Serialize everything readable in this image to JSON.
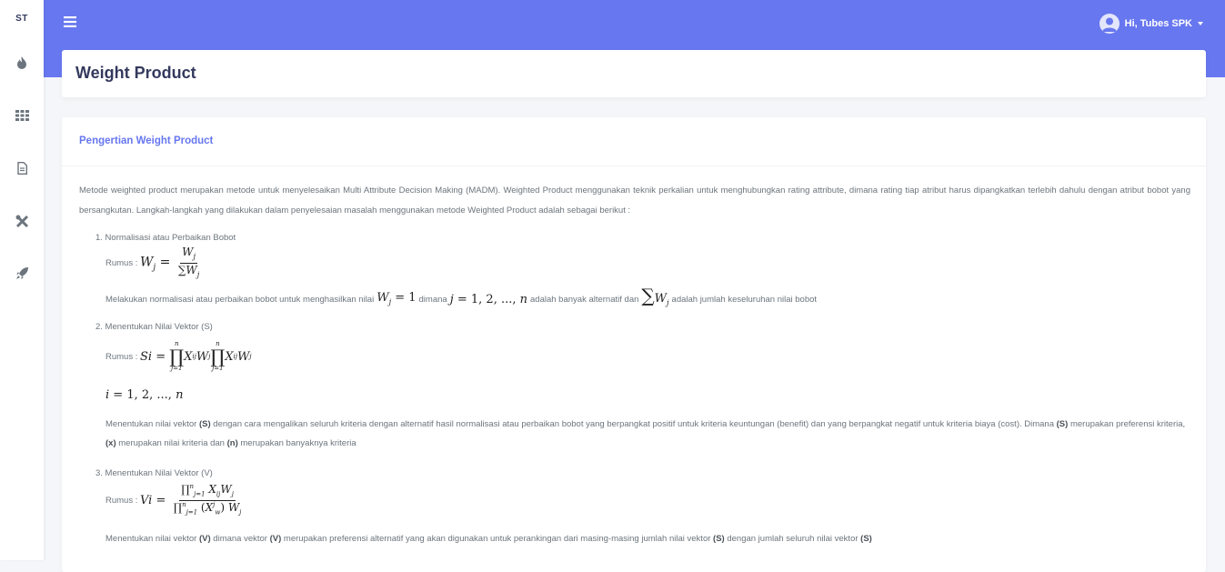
{
  "sidebar": {
    "brand": "ST",
    "icons": [
      "fire-icon",
      "grid-icon",
      "file-icon",
      "tools-icon",
      "rocket-icon"
    ]
  },
  "navbar": {
    "user_greeting": "Hi, Tubes SPK",
    "accent_color": "#6777ef"
  },
  "page": {
    "title": "Weight Product"
  },
  "card": {
    "title": "Pengertian Weight Product",
    "intro": "Metode weighted product merupakan metode untuk menyelesaikan Multi Attribute Decision Making (MADM). Weighted Product menggunakan teknik perkalian untuk menghubungkan rating attribute, dimana rating tiap atribut harus dipangkatkan terlebih dahulu dengan atribut bobot yang bersangkutan. Langkah-langkah yang dilakukan dalam penyelesaian masalah menggunakan metode Weighted Product adalah sebagai berikut :",
    "steps": [
      {
        "title": "1. Normalisasi atau Perbaikan Bobot",
        "rumus_label": "Rumus :",
        "desc_parts": [
          "Melakukan normalisasi atau perbaikan bobot untuk menghasilkan nilai",
          "dimana",
          "adalah banyak alternatif dan",
          "adalah jumlah keseluruhan nilai bobot"
        ]
      },
      {
        "title": "2. Menentukan Nilai Vektor (S)",
        "rumus_label": "Rumus :",
        "desc_parts": [
          "Menentukan nilai vektor",
          "(S)",
          "dengan cara mengalikan seluruh kriteria dengan alternatif hasil normalisasi atau perbaikan bobot yang berpangkat positif untuk kriteria keuntungan (benefit) dan yang berpangkat negatif untuk kriteria biaya (cost). Dimana",
          "(S)",
          "merupakan preferensi kriteria,",
          "(x)",
          "merupakan nilai kriteria dan",
          "(n)",
          "merupakan banyaknya kriteria"
        ]
      },
      {
        "title": "3. Menentukan Nilai Vektor (V)",
        "rumus_label": "Rumus :",
        "desc_parts": [
          "Menentukan nilai vektor",
          "(V)",
          "dimana vektor",
          "(V)",
          "merupakan preferensi alternatif yang akan digunakan untuk perankingan dari masing-masing jumlah nilai vektor",
          "(S)",
          "dengan jumlah seluruh nilai vektor",
          "(S)"
        ]
      }
    ]
  }
}
